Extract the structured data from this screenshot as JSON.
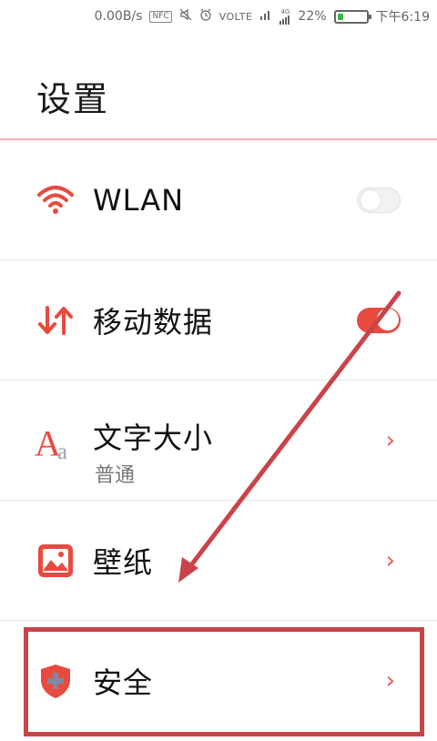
{
  "status_bar": {
    "net_speed": "0.00B/s",
    "nfc": "NFC",
    "volte": "VOLTE",
    "signal_tag": "4G",
    "battery_percent": "22%",
    "battery_level": 0.22,
    "time": "下午6:19"
  },
  "header": {
    "title": "设置"
  },
  "settings": {
    "wlan": {
      "label": "WLAN",
      "icon": "wifi-icon",
      "toggle_on": false
    },
    "mobile_data": {
      "label": "移动数据",
      "icon": "data-transfer-arrows-icon",
      "toggle_on": true
    },
    "font_size": {
      "label": "文字大小",
      "value": "普通",
      "icon": "font-size-icon"
    },
    "wallpaper": {
      "label": "壁纸",
      "icon": "image-icon"
    },
    "security": {
      "label": "安全",
      "icon": "shield-plus-icon"
    }
  },
  "chevron": "›",
  "colors": {
    "accent": "#e84a3f",
    "annotation": "#c94449",
    "divider": "#e4e4e4"
  }
}
